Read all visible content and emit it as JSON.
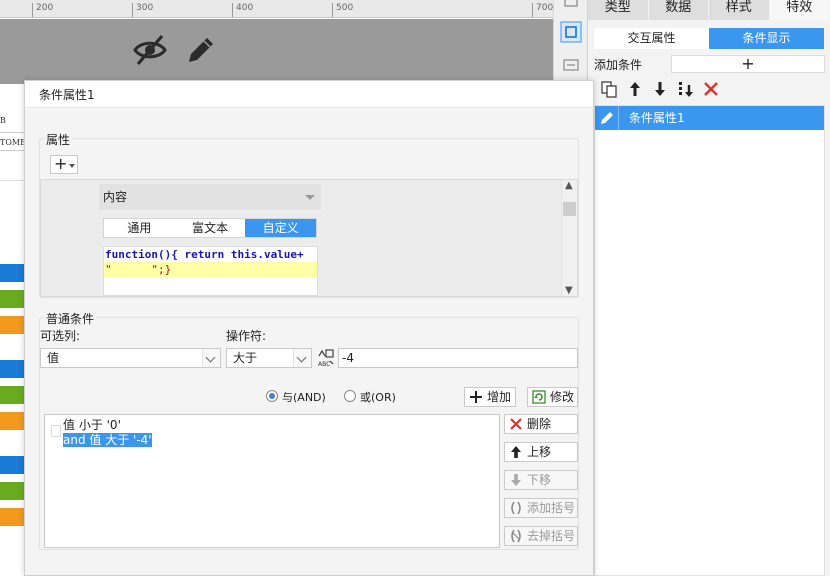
{
  "ruler": {
    "ticks": [
      "200",
      "300",
      "400",
      "500",
      "700"
    ]
  },
  "strip": {
    "header": "B",
    "cell_text": "TOME"
  },
  "right_panel": {
    "tabs": [
      "类型",
      "数据",
      "样式",
      "特效"
    ],
    "subtabs": [
      "交互属性",
      "条件显示"
    ],
    "add_condition_label": "添加条件",
    "add_condition_button": "+",
    "list_items": [
      "条件属性1"
    ]
  },
  "dialog": {
    "title": "条件属性1",
    "attr_group_title": "属性",
    "add_attr_button": "+",
    "content_select": "内容",
    "segments": [
      "通用",
      "富文本",
      "自定义"
    ],
    "code_lines": [
      "function(){ return this.value+",
      "\"      \";}"
    ],
    "cond_group_title": "普通条件",
    "column_label": "可选列:",
    "column_value": "值",
    "operator_label": "操作符:",
    "operator_value": "大于",
    "value_input": "-4",
    "radio_and": "与(AND)",
    "radio_or": "或(OR)",
    "add_button": "增加",
    "modify_button": "修改",
    "conditions": [
      "值 小于 '0'",
      "and 值 大于 '-4'"
    ],
    "side_buttons": {
      "delete": "删除",
      "up": "上移",
      "down": "下移",
      "add_bracket": "添加括号",
      "remove_bracket": "去掉括号"
    }
  },
  "colors": {
    "accent": "#3b96f0",
    "delete_red": "#e03030",
    "green": "#6aaa1e",
    "orange": "#f39a1e"
  }
}
